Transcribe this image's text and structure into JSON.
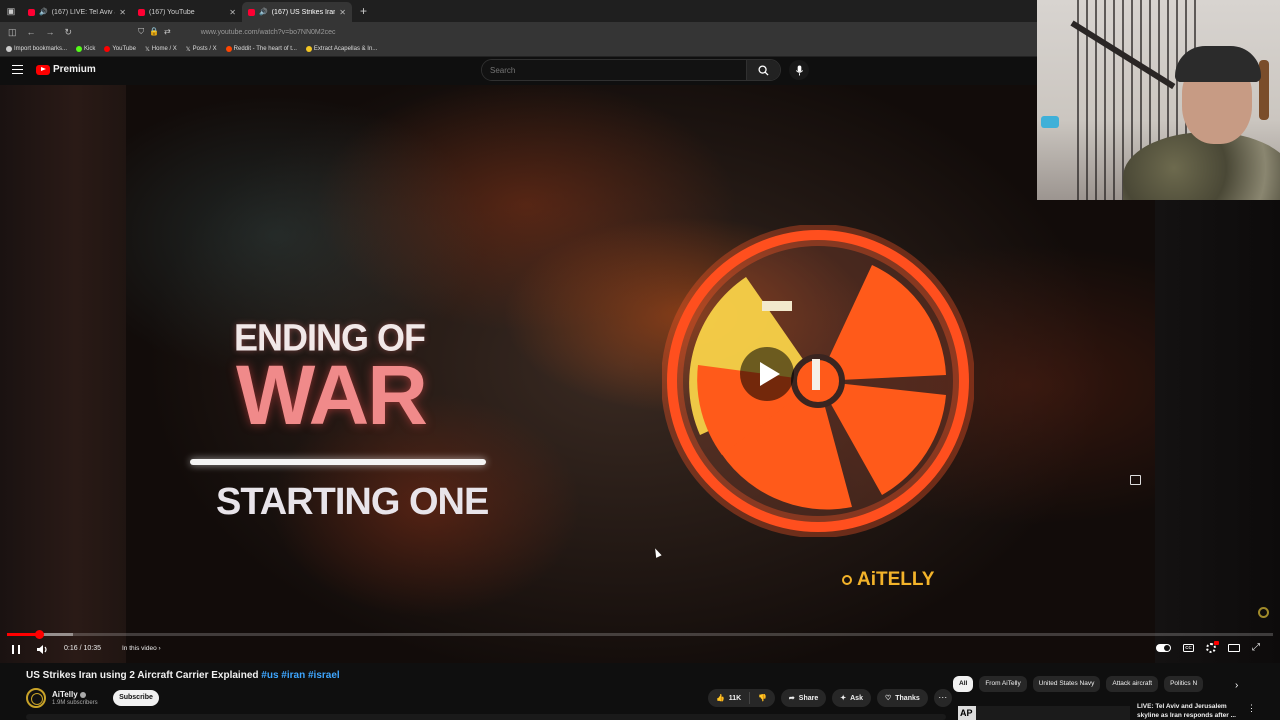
{
  "browser": {
    "tabs": [
      {
        "label": "(167) LIVE: Tel Aviv and Jeru",
        "active": false
      },
      {
        "label": "(167) YouTube",
        "active": false
      },
      {
        "label": "(167) US Strikes Iran using",
        "active": true
      }
    ],
    "new_tab": "+",
    "url": "www.youtube.com/watch?v=bo7NN0M2cec",
    "bookmarks": [
      {
        "label": "Import bookmarks...",
        "color": "#cccccc"
      },
      {
        "label": "Kick",
        "color": "#53fc18"
      },
      {
        "label": "YouTube",
        "color": "#ff0000"
      },
      {
        "label": "Home / X",
        "color": "#ffffff"
      },
      {
        "label": "Posts / X",
        "color": "#ffffff"
      },
      {
        "label": "Reddit - The heart of t...",
        "color": "#ff4500"
      },
      {
        "label": "Extract Acapellas & In...",
        "color": "#f3c623"
      }
    ]
  },
  "masthead": {
    "logo_text": "Premium",
    "search_placeholder": "Search"
  },
  "video": {
    "thumbnail_text": {
      "line1": "ENDING OF",
      "line2": "WAR",
      "line3": "STARTING ONE",
      "brand": "AiTELLY"
    },
    "progress_fraction": 0.025,
    "buffer_fraction": 0.052,
    "time": "0:16 / 10:35",
    "chapter": "In this video ›"
  },
  "info": {
    "title": "US Strikes Iran using 2 Aircraft Carrier Explained",
    "hashtags": [
      "#us",
      "#iran",
      "#israel"
    ],
    "channel": "AiTelly",
    "subscribers": "1.9M subscribers",
    "subscribe_label": "Subscribe",
    "likes": "11K",
    "share_label": "Share",
    "ask_label": "Ask",
    "thanks_label": "Thanks",
    "more_label": "···"
  },
  "recommendations": {
    "chips": [
      "All",
      "From AiTelly",
      "United States Navy",
      "Attack aircraft",
      "Politics N"
    ],
    "first": {
      "thumb_label": "AP",
      "title": "LIVE: Tel Aviv and Jerusalem skyline as Iran responds after ..."
    }
  },
  "colors": {
    "accent": "#ff0000",
    "link": "#3ea6ff",
    "brand_gold": "#f3b32a"
  }
}
